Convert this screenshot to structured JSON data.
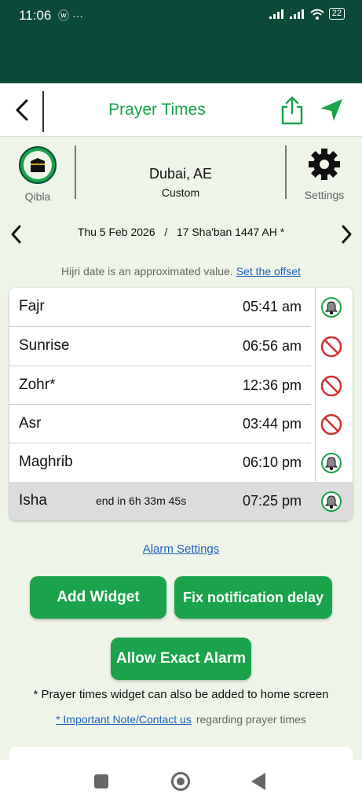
{
  "status_bar": {
    "time": "11:06",
    "left_icons": "ⓦ ···",
    "battery": "22"
  },
  "app_bar": {
    "title": "Prayer Times"
  },
  "location": {
    "qibla_label": "Qibla",
    "city": "Dubai, AE",
    "method": "Custom",
    "settings_label": "Settings"
  },
  "date": {
    "gregorian": "Thu 5 Feb 2026",
    "separator": "/",
    "hijri": "17 Sha'ban 1447 AH *"
  },
  "hijri_note": {
    "text": "Hijri date is an approximated value.",
    "link": "Set the offset"
  },
  "prayers": [
    {
      "name": "Fajr",
      "time": "05:41 am",
      "alarm": "on"
    },
    {
      "name": "Sunrise",
      "time": "06:56 am",
      "alarm": "off"
    },
    {
      "name": "Zohr*",
      "time": "12:36 pm",
      "alarm": "off"
    },
    {
      "name": "Asr",
      "time": "03:44 pm",
      "alarm": "off"
    },
    {
      "name": "Maghrib",
      "time": "06:10 pm",
      "alarm": "on"
    },
    {
      "name": "Isha",
      "time": "07:25 pm",
      "end_text": "end in 6h 33m 45s",
      "alarm": "on"
    }
  ],
  "alarm_settings": "Alarm Settings",
  "buttons": {
    "add_widget": "Add Widget",
    "fix_notification": "Fix notification delay",
    "allow_exact_alarm": "Allow Exact Alarm"
  },
  "widget_note": "* Prayer times widget can also be added to home screen",
  "contact": {
    "link": "* Important Note/Contact us",
    "suffix": "regarding prayer times"
  },
  "colors": {
    "primary_green": "#1aa34a",
    "status_bar": "#0b4a38",
    "alarm_off_red": "#d32f2f",
    "link_blue": "#1e63b8"
  }
}
